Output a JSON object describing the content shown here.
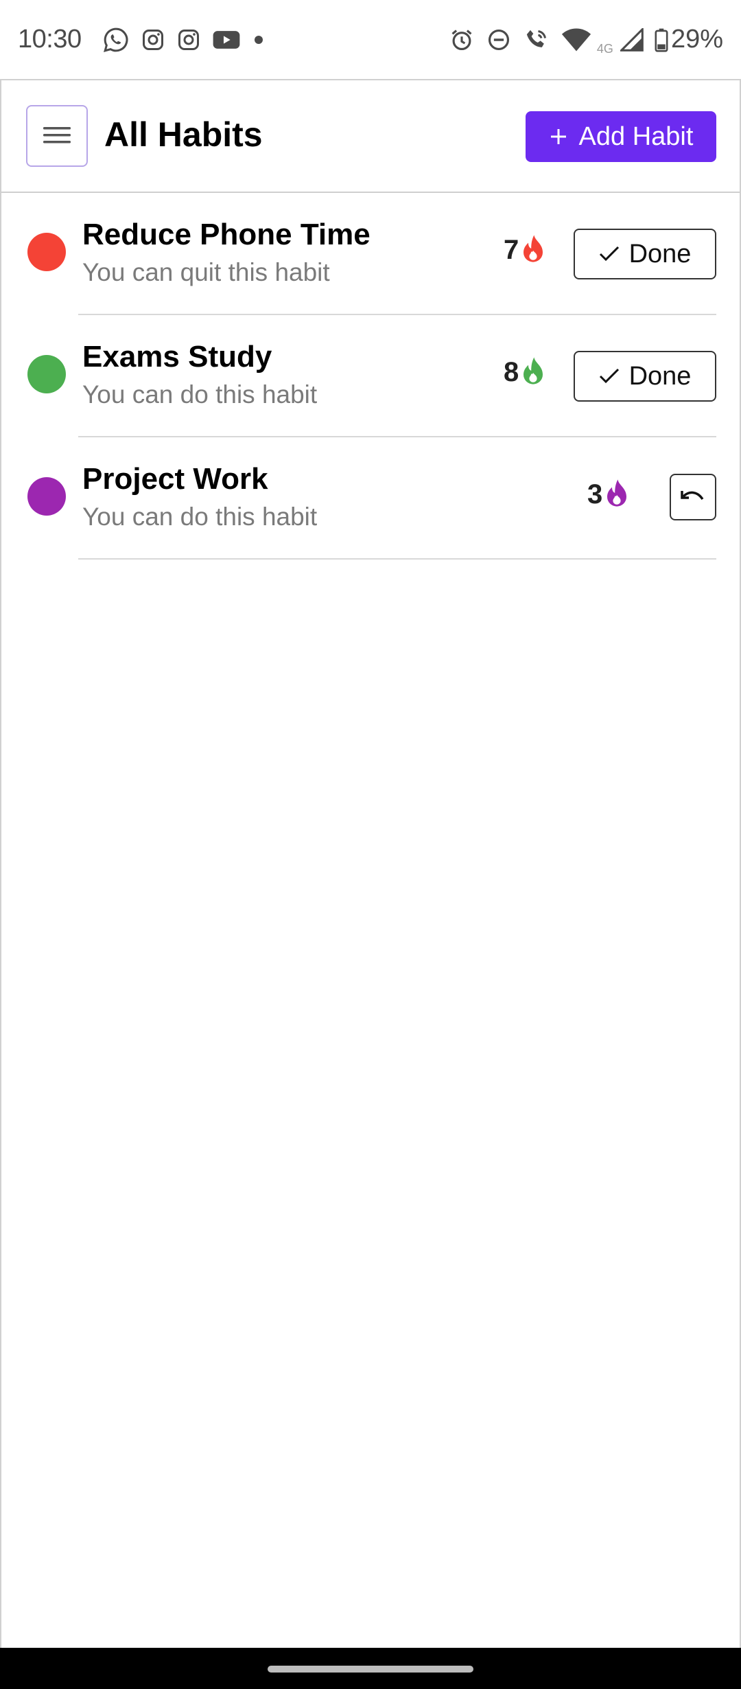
{
  "status_bar": {
    "time": "10:30",
    "battery": "29%",
    "network_label": "4G",
    "left_icons": [
      "whatsapp-icon",
      "instagram-icon",
      "instagram-icon",
      "youtube-icon",
      "dot-icon"
    ],
    "right_icons": [
      "alarm-icon",
      "dnd-icon",
      "wifi-call-icon",
      "wifi-icon",
      "signal-icon",
      "battery-icon"
    ]
  },
  "header": {
    "title": "All Habits",
    "add_label": "Add Habit",
    "menu_icon": "hamburger-icon"
  },
  "colors": {
    "accent": "#6c2bf0",
    "red": "#f44336",
    "green": "#4caf50",
    "purple": "#9c27b0"
  },
  "habits": [
    {
      "name": "Reduce Phone Time",
      "subtitle": "You can quit this habit",
      "streak": "7",
      "color": "#f44336",
      "action": "Done",
      "action_icon": "check-icon"
    },
    {
      "name": "Exams Study",
      "subtitle": "You can do this habit",
      "streak": "8",
      "color": "#4caf50",
      "action": "Done",
      "action_icon": "check-icon"
    },
    {
      "name": "Project Work",
      "subtitle": "You can do this habit",
      "streak": "3",
      "color": "#9c27b0",
      "action": "",
      "action_icon": "undo-icon"
    }
  ]
}
